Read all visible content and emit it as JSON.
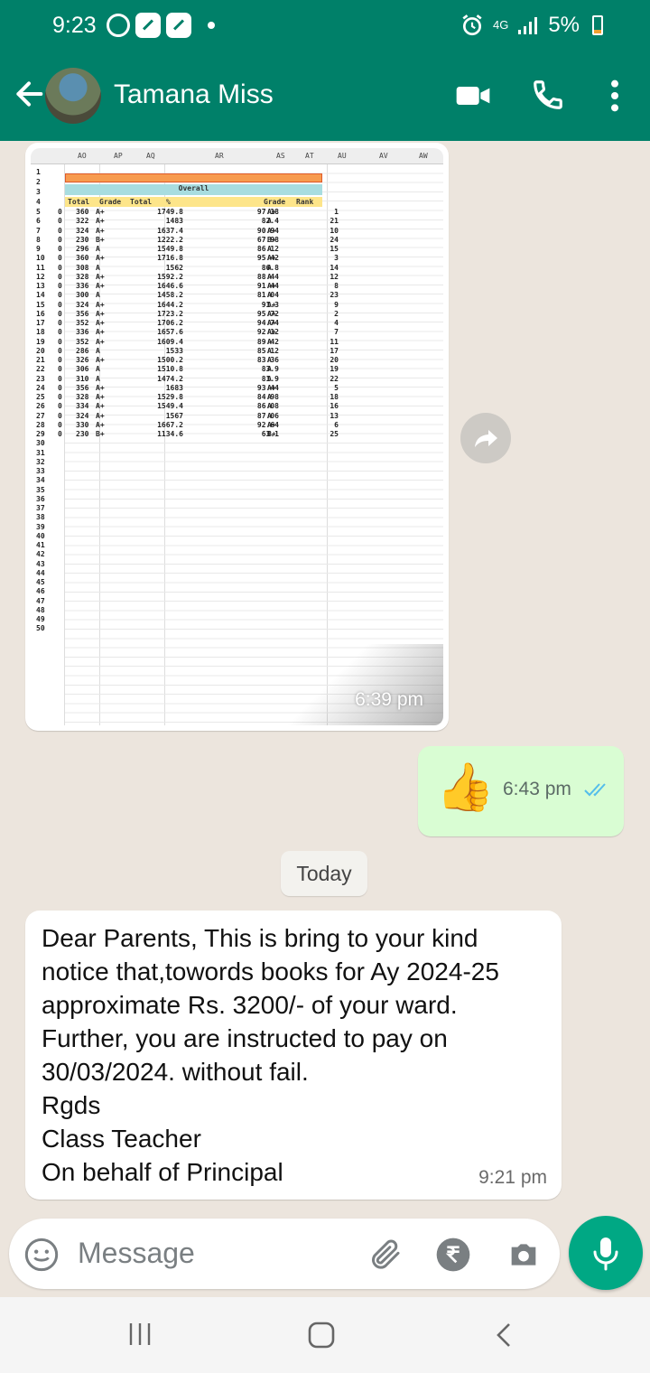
{
  "status_bar": {
    "time": "9:23",
    "network": "4G",
    "battery": "5%"
  },
  "header": {
    "contact_name": "Tamana Miss"
  },
  "messages": {
    "image": {
      "time": "6:39 pm",
      "spreadsheet": {
        "columns": [
          "AO",
          "AP",
          "AQ",
          "AR",
          "AS",
          "AT",
          "AU",
          "AV",
          "AW"
        ],
        "title_row": "Overall",
        "header_row": [
          "Total",
          "Grade",
          "Total",
          "%",
          "Grade",
          "Rank"
        ],
        "rows": [
          [
            "5",
            "0",
            "360",
            "A+",
            "1749.8",
            "97.18",
            "A+",
            "1"
          ],
          [
            "6",
            "0",
            "322",
            "A+",
            "1483",
            "82.4",
            "A",
            "21"
          ],
          [
            "7",
            "0",
            "324",
            "A+",
            "1637.4",
            "90.94",
            "A+",
            "10"
          ],
          [
            "8",
            "0",
            "230",
            "B+",
            "1222.2",
            "67.98",
            "B+",
            "24"
          ],
          [
            "9",
            "0",
            "296",
            "A",
            "1549.8",
            "86.12",
            "A",
            "15"
          ],
          [
            "10",
            "0",
            "360",
            "A+",
            "1716.8",
            "95.42",
            "A+",
            "3"
          ],
          [
            "11",
            "0",
            "308",
            "A",
            "1562",
            "86.8",
            "A",
            "14"
          ],
          [
            "12",
            "0",
            "328",
            "A+",
            "1592.2",
            "88.44",
            "A",
            "12"
          ],
          [
            "13",
            "0",
            "336",
            "A+",
            "1646.6",
            "91.44",
            "A+",
            "8"
          ],
          [
            "14",
            "0",
            "300",
            "A",
            "1458.2",
            "81.04",
            "A",
            "23"
          ],
          [
            "15",
            "0",
            "324",
            "A+",
            "1644.2",
            "91.3",
            "A+",
            "9"
          ],
          [
            "16",
            "0",
            "356",
            "A+",
            "1723.2",
            "95.72",
            "A+",
            "2"
          ],
          [
            "17",
            "0",
            "352",
            "A+",
            "1706.2",
            "94.74",
            "A+",
            "4"
          ],
          [
            "18",
            "0",
            "336",
            "A+",
            "1657.6",
            "92.12",
            "A+",
            "7"
          ],
          [
            "19",
            "0",
            "352",
            "A+",
            "1609.4",
            "89.42",
            "A",
            "11"
          ],
          [
            "20",
            "0",
            "286",
            "A",
            "1533",
            "85.12",
            "A",
            "17"
          ],
          [
            "21",
            "0",
            "326",
            "A+",
            "1500.2",
            "83.36",
            "A",
            "20"
          ],
          [
            "22",
            "0",
            "306",
            "A",
            "1510.8",
            "83.9",
            "A",
            "19"
          ],
          [
            "23",
            "0",
            "310",
            "A",
            "1474.2",
            "81.9",
            "A",
            "22"
          ],
          [
            "24",
            "0",
            "356",
            "A+",
            "1683",
            "93.44",
            "A+",
            "5"
          ],
          [
            "25",
            "0",
            "328",
            "A+",
            "1529.8",
            "84.98",
            "A",
            "18"
          ],
          [
            "26",
            "0",
            "334",
            "A+",
            "1549.4",
            "86.08",
            "A",
            "16"
          ],
          [
            "27",
            "0",
            "324",
            "A+",
            "1567",
            "87.06",
            "A",
            "13"
          ],
          [
            "28",
            "0",
            "330",
            "A+",
            "1667.2",
            "92.64",
            "A+",
            "6"
          ],
          [
            "29",
            "0",
            "230",
            "B+",
            "1134.6",
            "63.1",
            "B+",
            "25"
          ]
        ],
        "empty_row_numbers": [
          "30",
          "31",
          "32",
          "33",
          "34",
          "35",
          "36",
          "37",
          "38",
          "39",
          "40",
          "41",
          "42",
          "43",
          "44",
          "45",
          "46",
          "47",
          "48",
          "49",
          "50"
        ]
      }
    },
    "outgoing": {
      "emoji": "👍",
      "time": "6:43 pm"
    },
    "date_divider": "Today",
    "incoming": {
      "text": "Dear Parents,                     This is bring to your kind notice that,towords books for Ay 2024-25 approximate Rs.  3200/- of your ward. Further, you are instructed to pay on 30/03/2024.   without fail.\nRgds\nClass Teacher\nOn behalf of Principal",
      "time": "9:21 pm"
    }
  },
  "composer": {
    "placeholder": "Message"
  },
  "colors": {
    "brand": "#008069",
    "outgoing_bubble": "#d9fdd3",
    "mic_button": "#00a884",
    "read_ticks": "#53bdeb"
  }
}
